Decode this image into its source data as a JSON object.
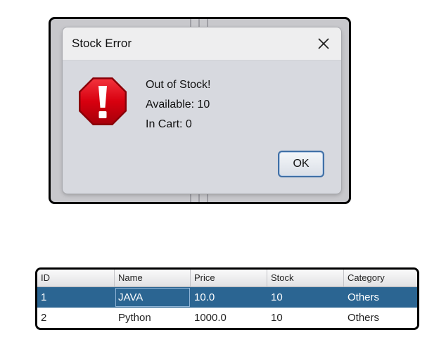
{
  "dialog": {
    "title": "Stock Error",
    "close_icon": "close-icon",
    "warning_icon": "stop-warning-icon",
    "message_lines": [
      "Out of Stock!",
      "Available: 10",
      "In Cart: 0"
    ],
    "ok_label": "OK"
  },
  "table": {
    "columns": [
      "ID",
      "Name",
      "Price",
      "Stock",
      "Category"
    ],
    "rows": [
      [
        "1",
        "JAVA",
        "10.0",
        "10",
        "Others"
      ],
      [
        "2",
        "Python",
        "1000.0",
        "10",
        "Others"
      ]
    ],
    "selected_row": 0
  },
  "colors": {
    "selection": "#2b6592",
    "warning_red": "#d8000f",
    "dialog_bg": "#d7d9df"
  }
}
